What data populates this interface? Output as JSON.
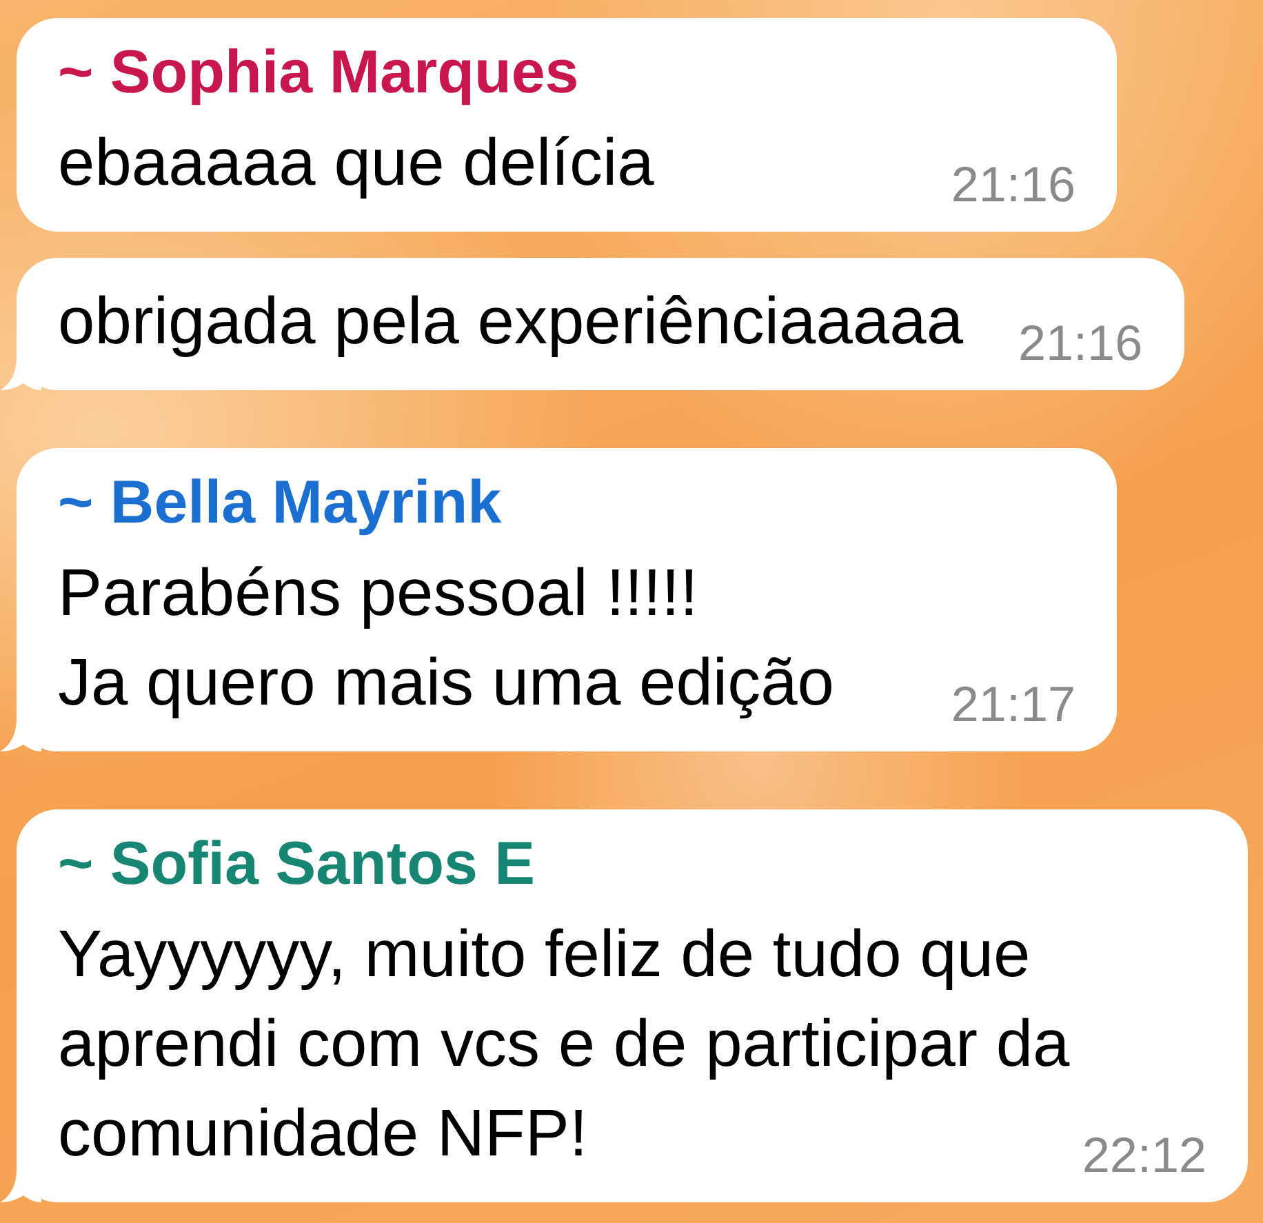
{
  "chat": {
    "groups": [
      {
        "sender": "~ Sophia Marques",
        "color": "#c8174c",
        "messages": [
          {
            "text": "ebaaaaa que delícia",
            "time": "21:16"
          },
          {
            "text": "obrigada pela experiênciaaaaa",
            "time": "21:16"
          }
        ]
      },
      {
        "sender": "~ Bella Mayrink",
        "color": "#1b6fd0",
        "messages": [
          {
            "text": "Parabéns pessoal !!!!!\nJa quero mais uma edição",
            "time": "21:17"
          }
        ]
      },
      {
        "sender": "~ Sofia Santos E",
        "color": "#168571",
        "messages": [
          {
            "text": "Yayyyyyy, muito feliz de tudo que aprendi com vcs e de participar da comunidade NFP!",
            "time": "22:12"
          }
        ]
      }
    ]
  }
}
